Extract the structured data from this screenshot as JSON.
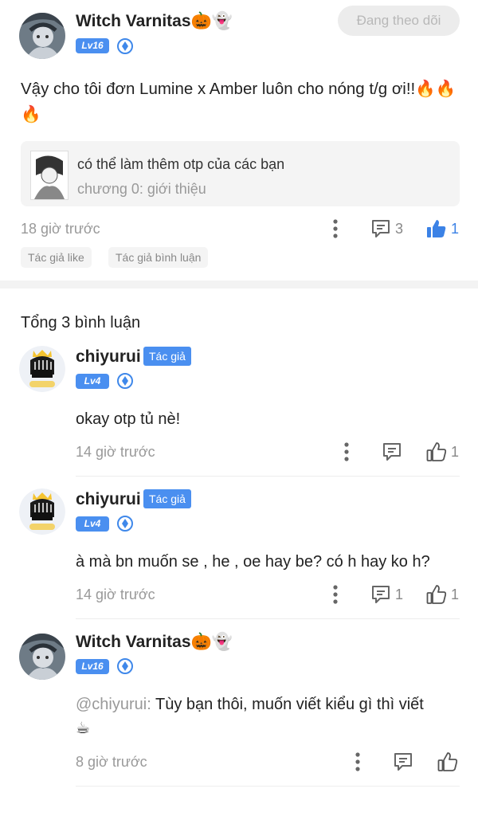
{
  "post": {
    "author_name": "Witch Varnitas",
    "author_emoji": "🎃👻",
    "level": "Lv16",
    "follow_label": "Đang theo dõi",
    "content": "Vậy cho tôi đơn Lumine x Amber luôn cho nóng t/g ơi!!🔥🔥🔥",
    "quote": {
      "text": "có thể làm thêm otp của các bạn",
      "chapter": "chương 0: giới thiệu"
    },
    "time": "18 giờ trước",
    "reply_count": "3",
    "like_count": "1",
    "tags": [
      "Tác giả like",
      "Tác giả bình luận"
    ]
  },
  "comments_header": "Tổng 3 bình luận",
  "replies": [
    {
      "author_name": "chiyurui",
      "author_tag": "Tác giả",
      "level": "Lv4",
      "text": "okay otp tủ nè!",
      "time": "14 giờ trước",
      "like_count": "1"
    },
    {
      "author_name": "chiyurui",
      "author_tag": "Tác giả",
      "level": "Lv4",
      "text": "à mà bn muốn se , he , oe hay be? có h hay ko h?",
      "time": "14 giờ trước",
      "reply_count": "1",
      "like_count": "1"
    },
    {
      "author_name": "Witch Varnitas",
      "author_emoji": "🎃👻",
      "level": "Lv16",
      "mention": "@chiyurui:",
      "text": " Tùy bạn thôi, muốn viết kiểu gì thì viết",
      "text_emoji": "☕",
      "time": "8 giờ trước"
    }
  ],
  "colors": {
    "accent": "#4a8ff0",
    "text": "#222222",
    "muted": "#999999",
    "quote_bg": "#f4f4f4",
    "follow_bg": "#ececec"
  }
}
